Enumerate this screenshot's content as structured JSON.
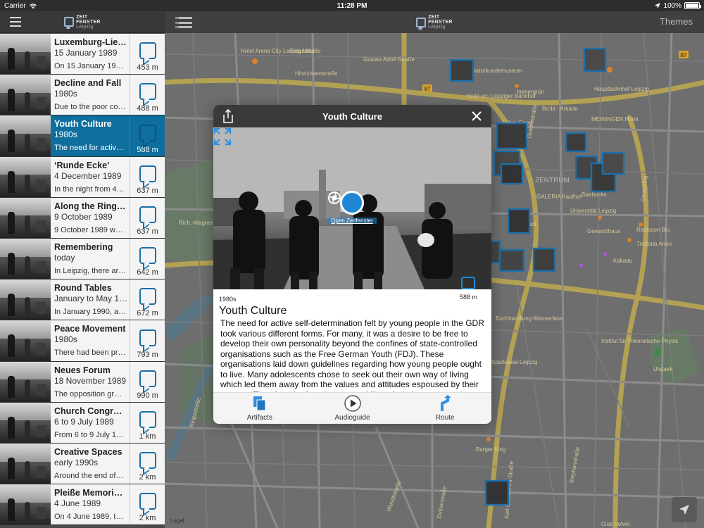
{
  "status": {
    "carrier": "Carrier",
    "time": "11:28 PM",
    "battery": "100%",
    "battery_level": 1.0
  },
  "sidebar": {
    "logo": {
      "line1": "ZEIT",
      "line2": "FENSTER",
      "line3": "Leipzig"
    },
    "items": [
      {
        "title": "Luxemburg-Lie…",
        "date": "15 January 1989",
        "snippet": "On 15 January 198…",
        "distance": "453 m"
      },
      {
        "title": "Decline and Fall",
        "date": "1980s",
        "snippet": "Due to the poor co…",
        "distance": "488 m"
      },
      {
        "title": "Youth Culture",
        "date": "1980s",
        "snippet": "The need for activ…",
        "distance": "588 m"
      },
      {
        "title": "‘Runde Ecke’",
        "date": "4 December 1989",
        "snippet": "In the night from 4…",
        "distance": "637 m"
      },
      {
        "title": "Along the Ring…",
        "date": "9 October 1989",
        "snippet": "9 October 1989 wa…",
        "distance": "637 m"
      },
      {
        "title": "Remembering",
        "date": "today",
        "snippet": "In Leipzig, there ar…",
        "distance": "642 m"
      },
      {
        "title": "Round Tables",
        "date": "January to May 1…",
        "snippet": "In January 1990, af…",
        "distance": "672 m"
      },
      {
        "title": "Peace Movement",
        "date": "1980s",
        "snippet": "There had been pr…",
        "distance": "793 m"
      },
      {
        "title": "Neues Forum",
        "date": "18 November 1989",
        "snippet": "The opposition gr…",
        "distance": "990 m"
      },
      {
        "title": "Church Congress",
        "date": "6 to 9 July 1989",
        "snippet": "From 6 to 9 July 19…",
        "distance": "1 km"
      },
      {
        "title": "Creative Spaces",
        "date": "early 1990s",
        "snippet": "Around the end of…",
        "distance": "2 km"
      },
      {
        "title": "Pleiße Memorial…",
        "date": "4 June 1989",
        "snippet": "On 4 June 1989, th…",
        "distance": "2 km"
      }
    ]
  },
  "map": {
    "themes_label": "Themes",
    "legal": "Legal",
    "labels": [
      "Hotel Arena City Leipzig Mitte",
      "Fregestraße",
      "Gustav-Adolf-Straße",
      "Hinrichsenstraße",
      "Naturkundemuseum",
      "Hotel am Leipziger Bahnhof",
      "Immergrün",
      "Brühl - Arkade",
      "Hauptbahnhof Leipzig",
      "Löhrs Carré",
      "MEININGER Hotel",
      "ZENTRUM",
      "GALERIA Kaufhof",
      "Starbucks",
      "Universität Leipzig",
      "Gewandhaus",
      "Radisson Blu",
      "Karstadt",
      "Trattoria Amici",
      "Kakadu",
      "Rich.-Wagner-Hain",
      "Buchhandlung Wasserfass",
      "Institut für Theoretische Physik",
      "Ulepark",
      "Sparkasse Leipzig",
      "Burger King",
      "Club Velvet",
      "Wundtstraße",
      "Dufourstraße",
      "Karl-Liebknecht-Straße",
      "Kingsstraße",
      "Georgiring",
      "Goethestraße",
      "Stephanstraße"
    ],
    "road_badges": [
      "87",
      "87"
    ]
  },
  "modal": {
    "title": "Youth Culture",
    "era": "1980s",
    "distance": "588 m",
    "open_label": "Open Zeitfenster",
    "heading": "Youth Culture",
    "body": "The need for active self-determination felt by young people in the GDR took various different forms. For many, it was a desire to be free to develop their own personality beyond the confines of state-controlled organisations such as the Free German Youth (FDJ). These organisations laid down guidelines regarding how young people ought to live. Many adolescents chose to seek out their own way of living which led them away from the values and attitudes espoused by their parents. They found refuge in groups of like-minded young people.",
    "tabs": [
      {
        "label": "Artifacts",
        "icon": "documents-icon"
      },
      {
        "label": "Audioguide",
        "icon": "play-icon"
      },
      {
        "label": "Route",
        "icon": "route-icon"
      }
    ]
  },
  "colors": {
    "accent": "#1e88d4",
    "selected_row": "#0e6e9e",
    "header": "#3a3a3a"
  }
}
